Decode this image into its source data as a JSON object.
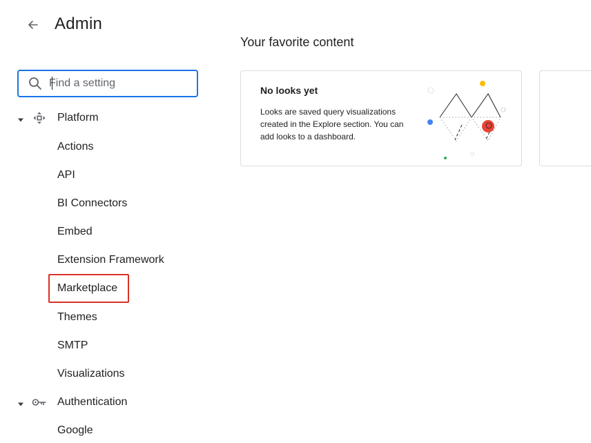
{
  "header": {
    "title": "Admin",
    "back_icon": "arrow-back-icon"
  },
  "search": {
    "placeholder": "Find a setting",
    "value": ""
  },
  "sidebar": {
    "sections": [
      {
        "label": "Platform",
        "icon": "platform-icon",
        "expanded": true,
        "items": [
          {
            "label": "Actions"
          },
          {
            "label": "API"
          },
          {
            "label": "BI Connectors"
          },
          {
            "label": "Embed"
          },
          {
            "label": "Extension Framework"
          },
          {
            "label": "Marketplace",
            "highlighted": true
          },
          {
            "label": "Themes"
          },
          {
            "label": "SMTP"
          },
          {
            "label": "Visualizations"
          }
        ]
      },
      {
        "label": "Authentication",
        "icon": "key-icon",
        "expanded": true,
        "items": [
          {
            "label": "Google"
          }
        ]
      }
    ]
  },
  "main": {
    "heading": "Your favorite content",
    "cards": [
      {
        "title": "No looks yet",
        "description": "Looks are saved query visualizations created in the Explore section. You can add looks to a dashboard."
      }
    ]
  },
  "colors": {
    "accent": "#1a73e8",
    "highlight": "#d93025",
    "illustration_red": "#ea4335",
    "illustration_yellow": "#fbbc04",
    "illustration_blue": "#4285f4",
    "illustration_green": "#34a853"
  }
}
